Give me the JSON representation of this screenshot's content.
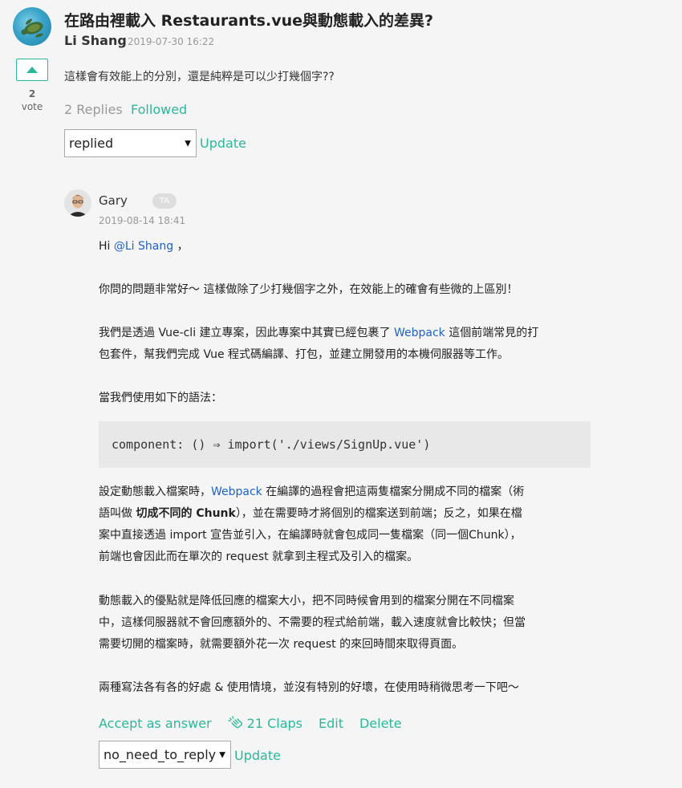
{
  "post": {
    "title": "在路由裡載入 Restaurants.vue與動態載入的差異?",
    "author": "Li Shang",
    "date": "2019-07-30 16:22",
    "vote_count": "2",
    "vote_label": "vote",
    "body": "這樣會有效能上的分別，還是純粹是可以少打幾個字??",
    "replies_count": "2 Replies",
    "followed_label": "Followed",
    "status_select": "replied",
    "update_label": "Update"
  },
  "reply": {
    "author": "Gary",
    "badge": "TA",
    "date": "2019-08-14 18:41",
    "greeting_prefix": "Hi ",
    "mention": "@Li Shang",
    "greeting_suffix": " ，",
    "p2": "你問的問題非常好～ 這樣做除了少打幾個字之外，在效能上的確會有些微的上區別！",
    "p3_a": "我們是透過 Vue-cli 建立專案，因此專案中其實已經包裹了 ",
    "p3_link": "Webpack",
    "p3_b": " 這個前端常見的打",
    "p3_c": "包套件，幫我們完成 Vue 程式碼編譯、打包，並建立開發用的本機伺服器等工作。",
    "p4": "當我們使用如下的語法：",
    "code": "component: () ⇒ import('./views/SignUp.vue')",
    "p5_a": "設定動態載入檔案時，",
    "p5_link": "Webpack",
    "p5_b": " 在編譯的過程會把這兩隻檔案分開成不同的檔案（術",
    "p5_c": "語叫做 ",
    "p5_bold": "切成不同的 Chunk",
    "p5_d": "），並在需要時才將個別的檔案送到前端；反之，如果在檔",
    "p5_e": "案中直接透過 import 宣告並引入，在編譯時就會包成同一隻檔案（同一個Chunk），",
    "p5_f": "前端也會因此而在單次的 request 就拿到主程式及引入的檔案。",
    "p6_a": "動態載入的優點就是降低回應的檔案大小，把不同時候會用到的檔案分開在不同檔案",
    "p6_b": "中，這樣伺服器就不會回應額外的、不需要的程式給前端，載入速度就會比較快；但當",
    "p6_c": "需要切開的檔案時，就需要額外花一次 request 的來回時間來取得頁面。",
    "p7": "兩種寫法各有各的好處 & 使用情境，並沒有特別的好壞，在使用時稍微思考一下吧～",
    "accept_label": "Accept as answer",
    "claps_label": "21 Claps",
    "edit_label": "Edit",
    "delete_label": "Delete",
    "status_select": "no_need_to_reply",
    "update_label": "Update"
  },
  "colors": {
    "accent": "#2bb89a",
    "link": "#1d62c7"
  },
  "icons": [
    "turtle-avatar",
    "caret-up-icon",
    "gary-avatar",
    "clap-icon",
    "dropdown-arrow-icon"
  ]
}
